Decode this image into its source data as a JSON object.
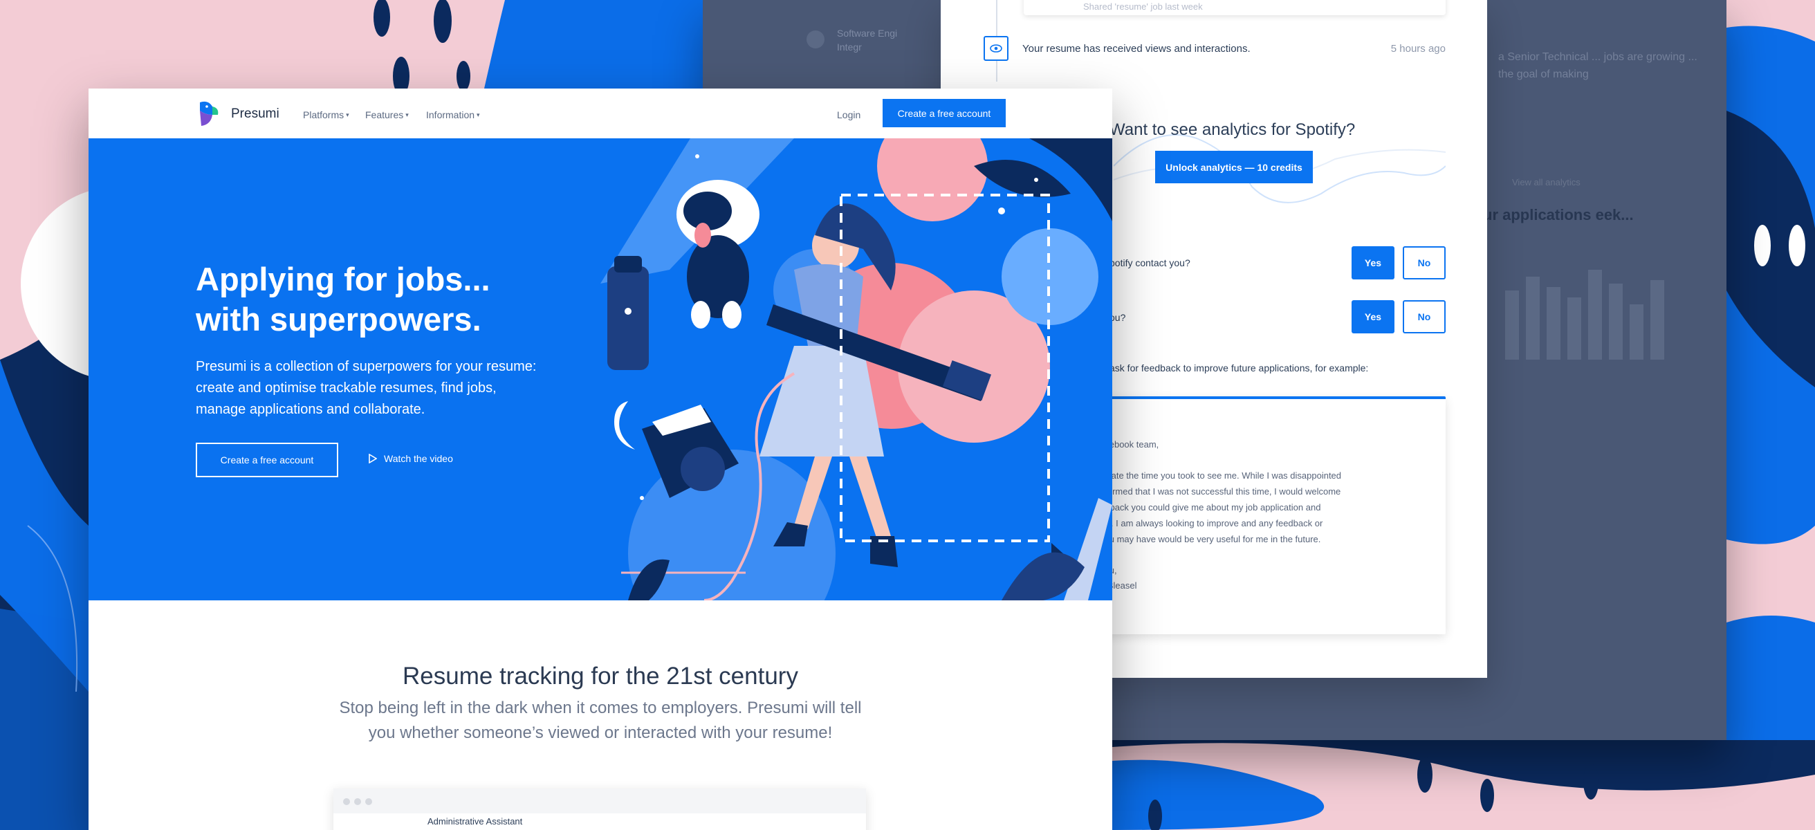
{
  "brand": {
    "name": "Presumi"
  },
  "nav": {
    "links": [
      "Platforms",
      "Features",
      "Information"
    ],
    "login": "Login",
    "cta": "Create a free account"
  },
  "hero": {
    "title_line1": "Applying for jobs...",
    "title_line2": "with superpowers.",
    "subtitle": "Presumi is a collection of superpowers for your resume: create and optimise trackable resumes, find jobs, manage applications and collaborate.",
    "cta": "Create a free account",
    "video": "Watch the video"
  },
  "section": {
    "title": "Resume tracking for the 21st century",
    "subtitle": "Stop being left in the dark when it comes to employers. Presumi will tell you whether someone’s viewed or interacted with your resume!"
  },
  "mini_browser": {
    "text": "Administrative Assistant"
  },
  "dashboard": {
    "left_item_title": "Software Engi",
    "left_item_sub": "Integr",
    "right_text": "a Senior Technical ... jobs are growing ... the goal of making",
    "right_small": "View all analytics",
    "right_title": "ur applications eek...",
    "notification": "Shared 'resume' job last week",
    "views_text": "Your resume has received views and interactions.",
    "views_time": "5 hours ago",
    "spotify_title": "Want to see analytics for Spotify?",
    "unlock": "Unlock analytics — 10 credits",
    "q1": "potify contact you?",
    "q2": "ou?",
    "yes": "Yes",
    "no": "No",
    "feedback_prompt": "ask for feedback to improve future applications, for example:",
    "letter": {
      "greeting": "acebook team,",
      "lines": [
        "eciate the time you took to see me. While I was disappointed",
        "nformed that I was not successful this time, I would welcome",
        "edback you could give me about my job application and",
        "ew. I am always looking to improve and any feedback or",
        " you may have would be very useful for me in the future."
      ],
      "signoff": "you,",
      "name": "n Bleasel"
    }
  },
  "colors": {
    "primary": "#0b74f1",
    "hero_bg": "#0a72f0",
    "navy": "#0b2a5e",
    "pink": "#f3ccd5",
    "text_dark": "#2b3a52"
  }
}
